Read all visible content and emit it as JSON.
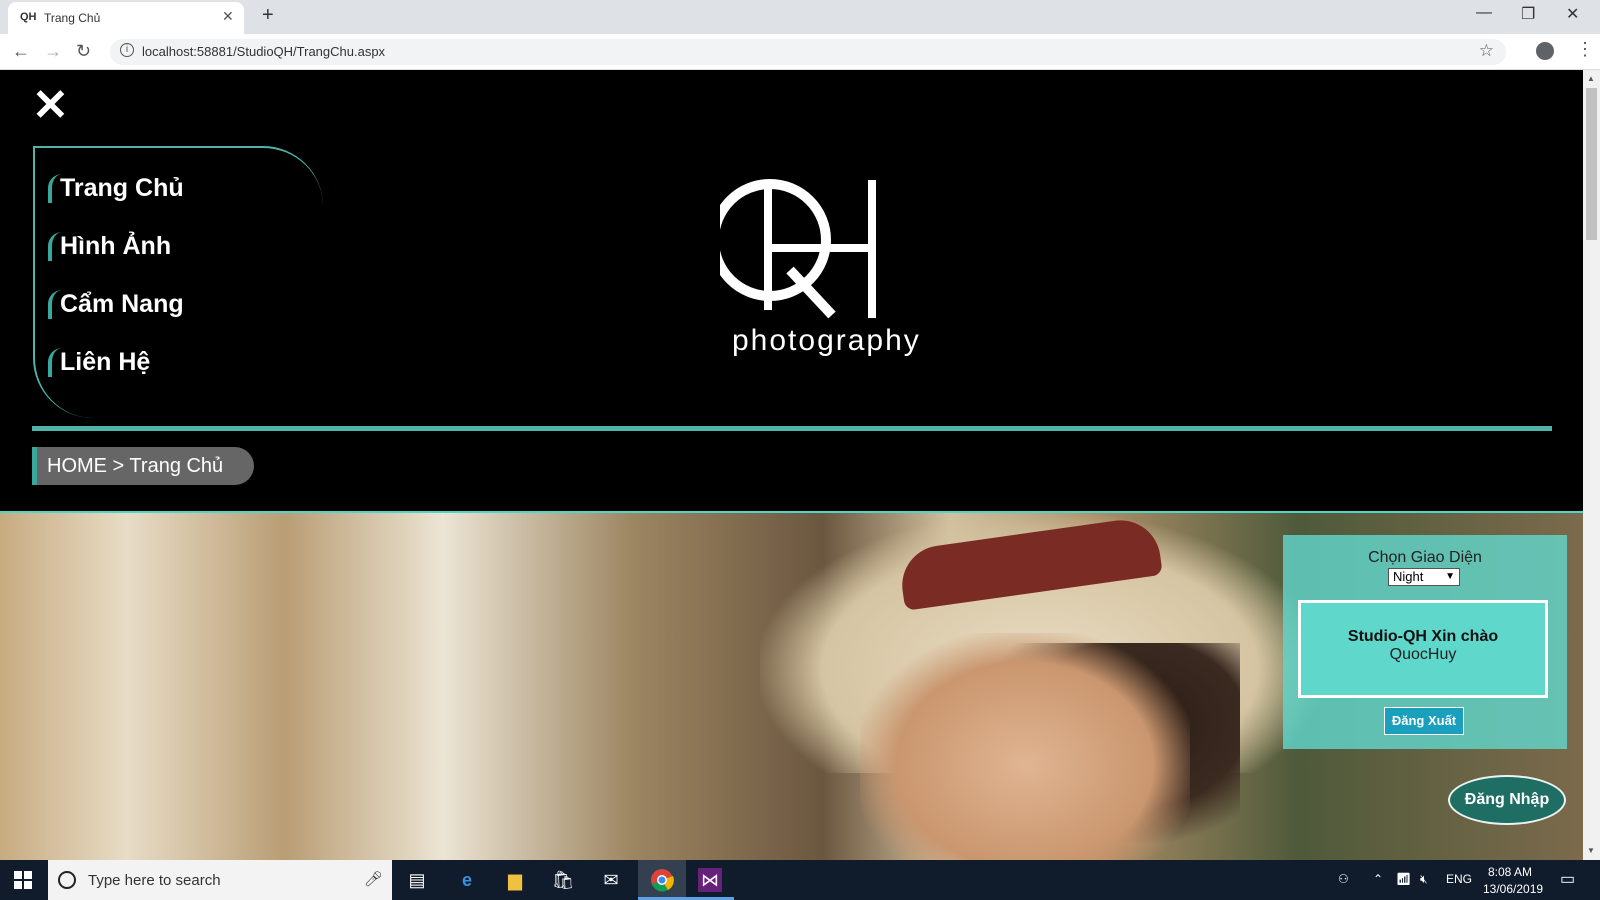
{
  "browser": {
    "tab_title": "Trang Chủ",
    "tab_favicon": "QH",
    "url": "localhost:58881/StudioQH/TrangChu.aspx"
  },
  "page": {
    "menu": [
      "Trang Chủ",
      "Hình Ảnh",
      "Cẩm Nang",
      "Liên Hệ"
    ],
    "logo_text": "photography",
    "breadcrumb": "HOME > Trang Chủ",
    "panel": {
      "title": "Chọn Giao Diện",
      "theme_selected": "Night",
      "greeting": "Studio-QH Xin chào",
      "username": "QuocHuy",
      "logout_label": "Đăng Xuất"
    },
    "login_label": "Đăng Nhập"
  },
  "taskbar": {
    "search_placeholder": "Type here to search",
    "language": "ENG",
    "time": "8:08 AM",
    "date": "13/06/2019"
  },
  "colors": {
    "accent": "#4fb3aa",
    "panel_bg": "#62d6cb",
    "logout_bg": "#1a9fbd",
    "login_bg": "#1f6e64"
  }
}
